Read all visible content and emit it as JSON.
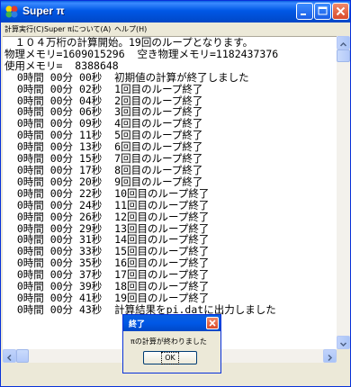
{
  "window": {
    "title": "Super π",
    "app_icon": "colorful-app-icon",
    "controls": {
      "minimize_icon": "minimize-icon",
      "maximize_icon": "maximize-icon",
      "close_icon": "close-icon"
    }
  },
  "menu": {
    "items": [
      {
        "label": "計算実行(C)"
      },
      {
        "label": "Super πについて(A)"
      },
      {
        "label": "ヘルプ(H)"
      }
    ]
  },
  "log": {
    "lines": [
      "　１０４万桁の計算開始。19回のループとなります。",
      "物理メモリ=1609015296  空き物理メモリ=1182437376",
      "使用メモリ=  8388648",
      "  0時間 00分 00秒  初期値の計算が終了しました",
      "  0時間 00分 02秒  1回目のループ終了",
      "  0時間 00分 04秒  2回目のループ終了",
      "  0時間 00分 06秒  3回目のループ終了",
      "  0時間 00分 09秒  4回目のループ終了",
      "  0時間 00分 11秒  5回目のループ終了",
      "  0時間 00分 13秒  6回目のループ終了",
      "  0時間 00分 15秒  7回目のループ終了",
      "  0時間 00分 17秒  8回目のループ終了",
      "  0時間 00分 20秒  9回目のループ終了",
      "  0時間 00分 22秒  10回目のループ終了",
      "  0時間 00分 24秒  11回目のループ終了",
      "  0時間 00分 26秒  12回目のループ終了",
      "  0時間 00分 29秒  13回目のループ終了",
      "  0時間 00分 31秒  14回目のループ終了",
      "  0時間 00分 33秒  15回目のループ終了",
      "  0時間 00分 35秒  16回目のループ終了",
      "  0時間 00分 37秒  17回目のループ終了",
      "  0時間 00分 39秒  18回目のループ終了",
      "  0時間 00分 41秒  19回目のループ終了",
      "  0時間 00分 43秒  計算結果をpi.datに出力しました"
    ]
  },
  "dialog": {
    "title": "終了",
    "message": "πの計算が終わりました",
    "ok_label": "OK"
  },
  "colors": {
    "titlebar": "#0058e6",
    "close_button": "#d94a2a",
    "window_face": "#ece9d8"
  }
}
